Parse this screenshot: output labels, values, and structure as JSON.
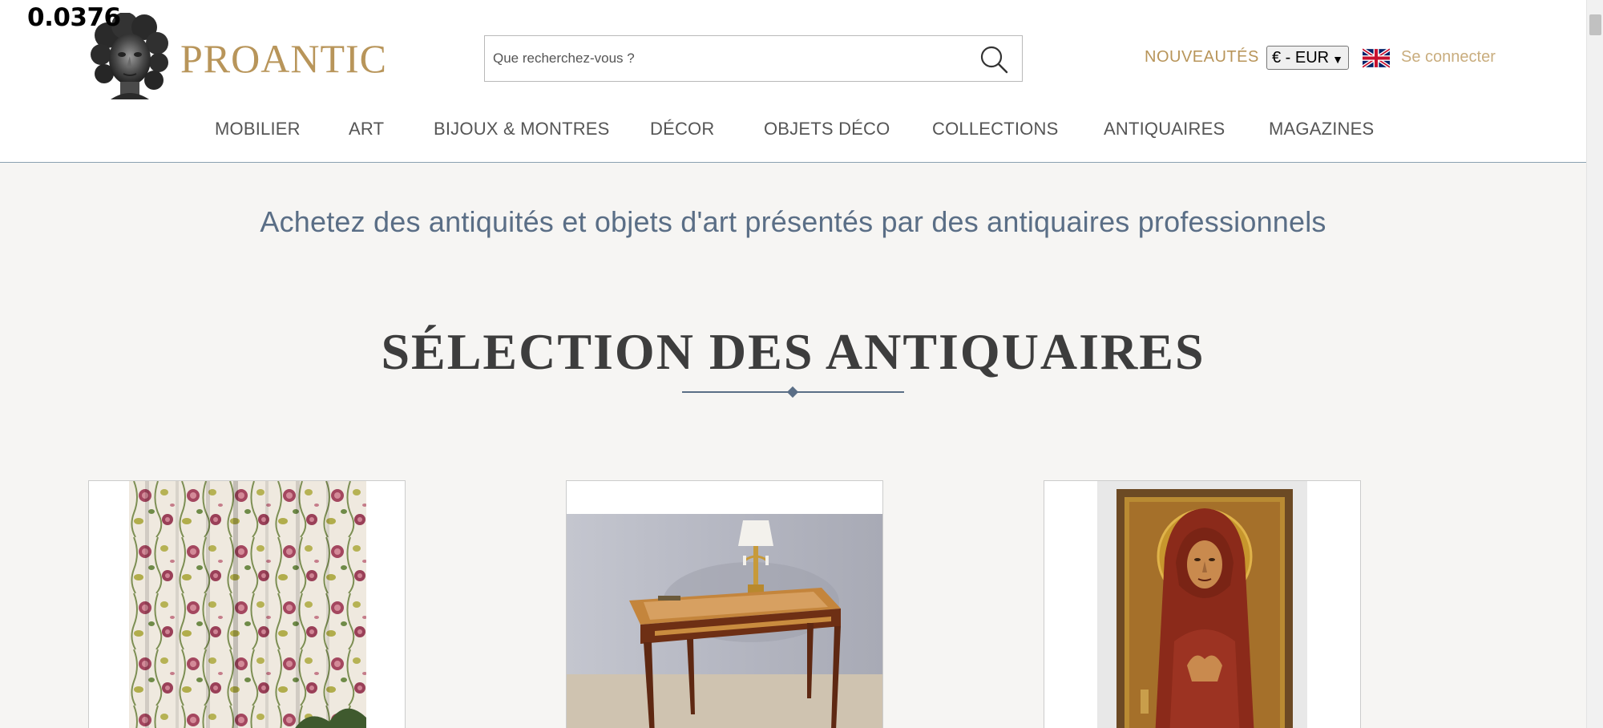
{
  "debug_value": "0.0376",
  "brand": {
    "name": "PROANTIC"
  },
  "search": {
    "placeholder": "Que recherchez-vous ?"
  },
  "header": {
    "nouveautes": "NOUVEAUTÉS",
    "currency": "€ - EUR",
    "login": "Se connecter"
  },
  "nav": [
    "MOBILIER",
    "ART",
    "BIJOUX & MONTRES",
    "DÉCOR",
    "OBJETS DÉCO",
    "COLLECTIONS",
    "ANTIQUAIRES",
    "MAGAZINES"
  ],
  "main": {
    "tagline": "Achetez des antiquités et objets d'art présentés par des antiquaires professionnels",
    "section_title": "SÉLECTION DES ANTIQUAIRES"
  },
  "colors": {
    "brand_gold": "#b8955a",
    "accent_blue": "#5a6e86",
    "background": "#f6f5f3"
  },
  "icons": {
    "search": "search-icon",
    "flag": "uk-flag-icon",
    "logo": "bust-logo-icon"
  }
}
